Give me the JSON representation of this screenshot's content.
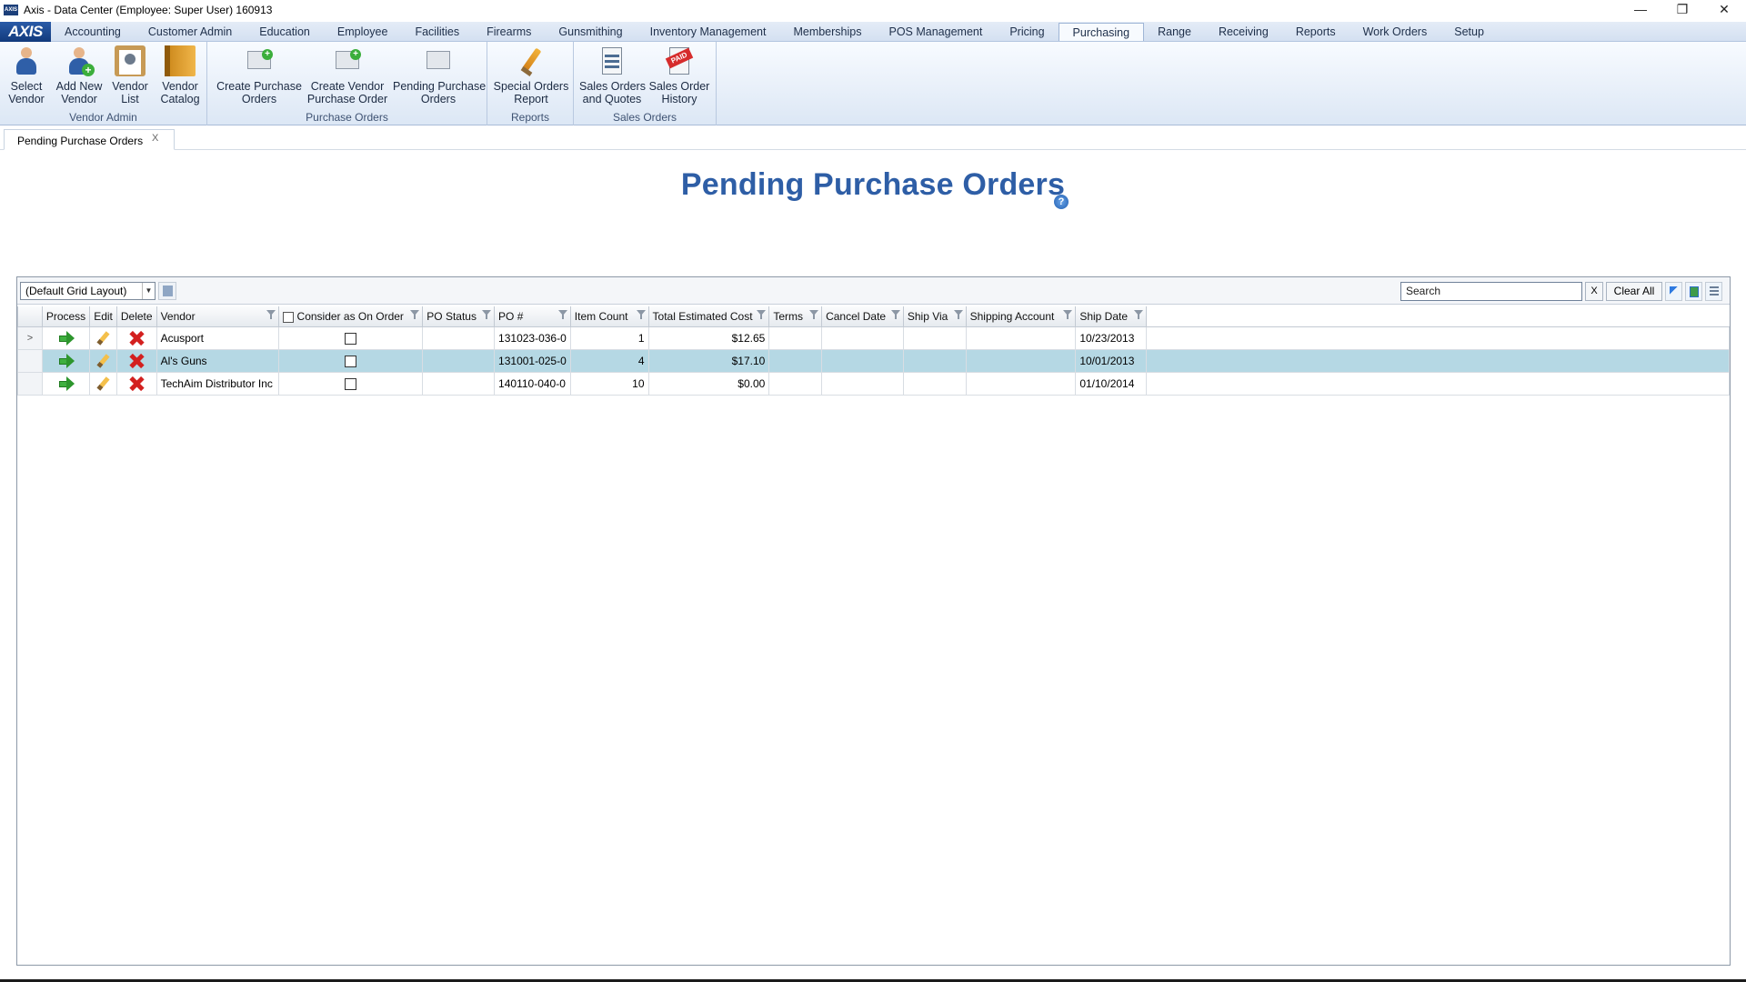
{
  "window": {
    "title": "Axis - Data Center  (Employee: Super User) 160913",
    "app_icon_text": "AXIS",
    "controls": {
      "minimize": "—",
      "maximize": "❐",
      "close": "✕"
    }
  },
  "menu": {
    "logo": "AXIS",
    "tabs": [
      "Accounting",
      "Customer Admin",
      "Education",
      "Employee",
      "Facilities",
      "Firearms",
      "Gunsmithing",
      "Inventory Management",
      "Memberships",
      "POS Management",
      "Pricing",
      "Purchasing",
      "Range",
      "Receiving",
      "Reports",
      "Work Orders",
      "Setup"
    ],
    "active": "Purchasing"
  },
  "ribbon": {
    "vendor_admin": {
      "label": "Vendor Admin",
      "buttons": [
        {
          "l1": "Select",
          "l2": "Vendor",
          "icon": "person-icon"
        },
        {
          "l1": "Add New",
          "l2": "Vendor",
          "icon": "add-person-icon"
        },
        {
          "l1": "Vendor",
          "l2": "List",
          "icon": "clipboard-icon"
        },
        {
          "l1": "Vendor",
          "l2": "Catalog",
          "icon": "catalog-book-icon"
        }
      ]
    },
    "purchase_orders": {
      "label": "Purchase Orders",
      "buttons": [
        {
          "l1": "Create Purchase",
          "l2": "Orders",
          "icon": "create-po-icon"
        },
        {
          "l1": "Create Vendor",
          "l2": "Purchase Order",
          "icon": "create-vendor-po-icon"
        },
        {
          "l1": "Pending Purchase",
          "l2": "Orders",
          "icon": "pending-po-icon"
        }
      ]
    },
    "reports": {
      "label": "Reports",
      "buttons": [
        {
          "l1": "Special Orders",
          "l2": "Report",
          "icon": "pencil-report-icon"
        }
      ]
    },
    "sales_orders": {
      "label": "Sales Orders",
      "buttons": [
        {
          "l1": "Sales Orders",
          "l2": "and Quotes",
          "icon": "sales-report-icon"
        },
        {
          "l1": "Sales Order",
          "l2": "History",
          "icon": "paid-stamp-icon"
        }
      ]
    }
  },
  "doc_tab": {
    "label": "Pending Purchase Orders",
    "close": "X"
  },
  "page": {
    "title": "Pending Purchase Orders",
    "help": "?"
  },
  "grid_toolbar": {
    "layout_value": "(Default Grid Layout)",
    "search_placeholder": "Search",
    "search_clear": "X",
    "clear_all": "Clear All"
  },
  "grid": {
    "columns": {
      "process": "Process",
      "edit": "Edit",
      "delete": "Delete",
      "vendor": "Vendor",
      "consider": "Consider as On Order",
      "po_status": "PO Status",
      "po_num": "PO #",
      "item_count": "Item Count",
      "total_cost": "Total Estimated Cost",
      "terms": "Terms",
      "cancel_date": "Cancel Date",
      "ship_via": "Ship Via",
      "shipping_account": "Shipping Account",
      "ship_date": "Ship Date"
    },
    "rows": [
      {
        "indicator": ">",
        "vendor": "Acusport",
        "consider": false,
        "po_status": "",
        "po_num": "131023-036-0",
        "item_count": "1",
        "total_cost": "$12.65",
        "terms": "",
        "cancel_date": "",
        "ship_via": "",
        "shipping_account": "",
        "ship_date": "10/23/2013"
      },
      {
        "indicator": "",
        "vendor": "Al's Guns",
        "consider": false,
        "po_status": "",
        "po_num": "131001-025-0",
        "item_count": "4",
        "total_cost": "$17.10",
        "terms": "",
        "cancel_date": "",
        "ship_via": "",
        "shipping_account": "",
        "ship_date": "10/01/2013"
      },
      {
        "indicator": "",
        "vendor": "TechAim Distributor Inc",
        "consider": false,
        "po_status": "",
        "po_num": "140110-040-0",
        "item_count": "10",
        "total_cost": "$0.00",
        "terms": "",
        "cancel_date": "",
        "ship_via": "",
        "shipping_account": "",
        "ship_date": "01/10/2014"
      }
    ],
    "selected_row": 1
  },
  "colors": {
    "accent": "#2e5ea6",
    "selection": "#b5d8e4",
    "menu_bg": "#d4e0f1"
  }
}
